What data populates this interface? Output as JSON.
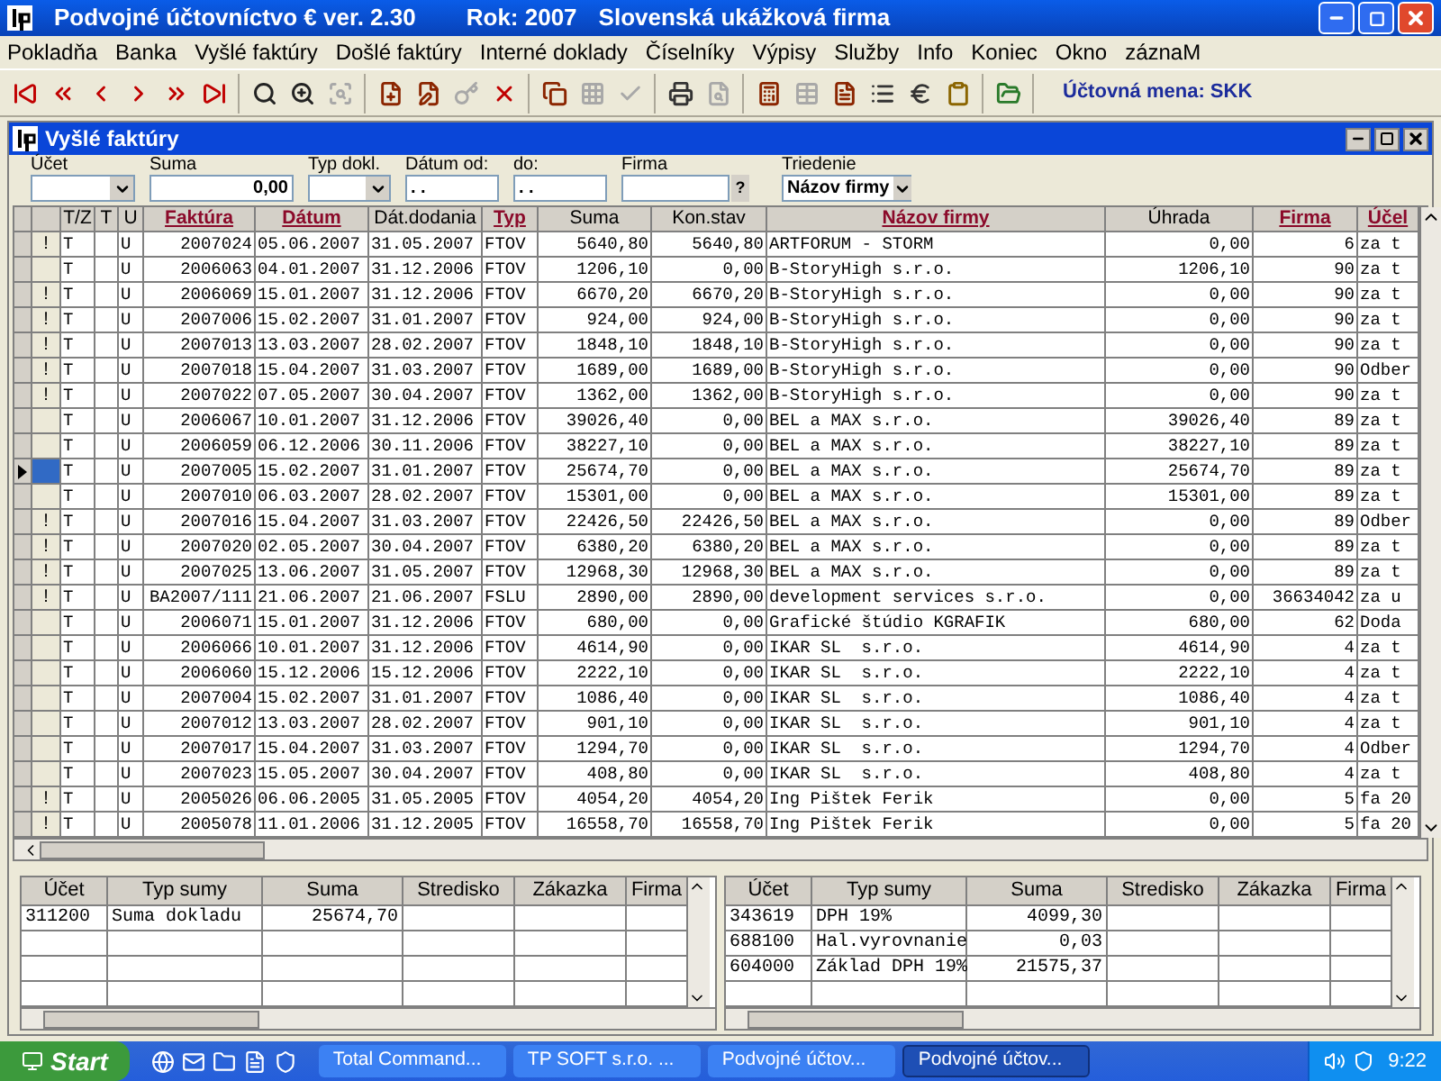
{
  "window": {
    "title": "Podvojné účtovníctvo € ver. 2.30",
    "year": "Rok: 2007",
    "company": "Slovenská ukážková firma"
  },
  "menu": [
    "Pokladňa",
    "Banka",
    "Vyšlé faktúry",
    "Došlé faktúry",
    "Interné doklady",
    "Číselníky",
    "Výpisy",
    "Služby",
    "Info",
    "Koniec",
    "Okno",
    "záznaM"
  ],
  "toolbar": {
    "groups": [
      [
        {
          "kind": "first",
          "disabled": false
        },
        {
          "kind": "prev-page",
          "disabled": false
        },
        {
          "kind": "prev",
          "disabled": false
        },
        {
          "kind": "next",
          "disabled": false
        },
        {
          "kind": "next-page",
          "disabled": false
        },
        {
          "kind": "last",
          "disabled": false
        }
      ],
      [
        {
          "kind": "search",
          "disabled": false
        },
        {
          "kind": "search-next",
          "disabled": false
        },
        {
          "kind": "filter",
          "disabled": true
        }
      ],
      [
        {
          "kind": "new",
          "disabled": false
        },
        {
          "kind": "edit",
          "disabled": false
        },
        {
          "kind": "key",
          "disabled": true
        },
        {
          "kind": "delete",
          "disabled": false
        }
      ],
      [
        {
          "kind": "copy",
          "disabled": false
        },
        {
          "kind": "grid",
          "disabled": true
        },
        {
          "kind": "check",
          "disabled": true
        }
      ],
      [
        {
          "kind": "print",
          "disabled": false
        },
        {
          "kind": "print-preview",
          "disabled": true
        }
      ],
      [
        {
          "kind": "calc",
          "disabled": false
        },
        {
          "kind": "table",
          "disabled": true
        },
        {
          "kind": "doc",
          "disabled": false
        },
        {
          "kind": "list",
          "disabled": false
        },
        {
          "kind": "euro",
          "disabled": false
        },
        {
          "kind": "clipboard",
          "disabled": false
        }
      ],
      [
        {
          "kind": "export",
          "disabled": false
        }
      ]
    ],
    "currency": "Účtovná mena: SKK"
  },
  "document_window": {
    "title": "Vyšlé faktúry"
  },
  "filters": [
    {
      "label": "Účet",
      "kind": "combo"
    },
    {
      "label": "Suma",
      "kind": "input",
      "value": "0,00"
    },
    {
      "label": "Typ dokl.",
      "kind": "combo"
    },
    {
      "label": "Dátum od:",
      "kind": "input",
      "value": ". ."
    },
    {
      "label": "do:",
      "kind": "input",
      "value": ". ."
    },
    {
      "label": "Firma",
      "kind": "lookup",
      "button": "?"
    },
    {
      "label": "Triedenie",
      "kind": "combo",
      "value": "Názov firmy"
    }
  ],
  "table": {
    "columns": [
      {
        "label": "T/Z",
        "sortable": false
      },
      {
        "label": "T",
        "sortable": false
      },
      {
        "label": "U",
        "sortable": false
      },
      {
        "label": "Faktúra",
        "sortable": true
      },
      {
        "label": "Dátum",
        "sortable": true
      },
      {
        "label": "Dát.dodania",
        "sortable": false
      },
      {
        "label": "Typ",
        "sortable": true
      },
      {
        "label": "Suma",
        "sortable": false
      },
      {
        "label": "Kon.stav",
        "sortable": false
      },
      {
        "label": "Názov firmy",
        "sortable": true
      },
      {
        "label": "Úhrada",
        "sortable": false
      },
      {
        "label": "Firma",
        "sortable": true
      },
      {
        "label": "Účel",
        "sortable": true
      }
    ],
    "rows": [
      {
        "selected": false,
        "flag": "!",
        "tz": "T",
        "u": "U",
        "invoice": "2007024",
        "date": "05.06.2007",
        "delivery": "31.05.2007",
        "type": "FTOV",
        "amount": "5640,80",
        "status": "5640,80",
        "company": "ARTFORUM - STORM",
        "payment": "0,00",
        "company_no": "6",
        "purpose": "za t"
      },
      {
        "selected": false,
        "tz": "T",
        "u": "U",
        "invoice": "2006063",
        "date": "04.01.2007",
        "delivery": "31.12.2006",
        "type": "FTOV",
        "amount": "1206,10",
        "status": "0,00",
        "company": "B-StoryHigh s.r.o.",
        "payment": "1206,10",
        "company_no": "90",
        "purpose": "za t"
      },
      {
        "selected": false,
        "flag": "!",
        "tz": "T",
        "u": "U",
        "invoice": "2006069",
        "date": "15.01.2007",
        "delivery": "31.12.2006",
        "type": "FTOV",
        "amount": "6670,20",
        "status": "6670,20",
        "company": "B-StoryHigh s.r.o.",
        "payment": "0,00",
        "company_no": "90",
        "purpose": "za t"
      },
      {
        "selected": false,
        "flag": "!",
        "tz": "T",
        "u": "U",
        "invoice": "2007006",
        "date": "15.02.2007",
        "delivery": "31.01.2007",
        "type": "FTOV",
        "amount": "924,00",
        "status": "924,00",
        "company": "B-StoryHigh s.r.o.",
        "payment": "0,00",
        "company_no": "90",
        "purpose": "za t"
      },
      {
        "selected": false,
        "flag": "!",
        "tz": "T",
        "u": "U",
        "invoice": "2007013",
        "date": "13.03.2007",
        "delivery": "28.02.2007",
        "type": "FTOV",
        "amount": "1848,10",
        "status": "1848,10",
        "company": "B-StoryHigh s.r.o.",
        "payment": "0,00",
        "company_no": "90",
        "purpose": "za t"
      },
      {
        "selected": false,
        "flag": "!",
        "tz": "T",
        "u": "U",
        "invoice": "2007018",
        "date": "15.04.2007",
        "delivery": "31.03.2007",
        "type": "FTOV",
        "amount": "1689,00",
        "status": "1689,00",
        "company": "B-StoryHigh s.r.o.",
        "payment": "0,00",
        "company_no": "90",
        "purpose": "Odber"
      },
      {
        "selected": false,
        "flag": "!",
        "tz": "T",
        "u": "U",
        "invoice": "2007022",
        "date": "07.05.2007",
        "delivery": "30.04.2007",
        "type": "FTOV",
        "amount": "1362,00",
        "status": "1362,00",
        "company": "B-StoryHigh s.r.o.",
        "payment": "0,00",
        "company_no": "90",
        "purpose": "za t"
      },
      {
        "selected": false,
        "tz": "T",
        "u": "U",
        "invoice": "2006067",
        "date": "10.01.2007",
        "delivery": "31.12.2006",
        "type": "FTOV",
        "amount": "39026,40",
        "status": "0,00",
        "company": "BEL a MAX s.r.o.",
        "payment": "39026,40",
        "company_no": "89",
        "purpose": "za t"
      },
      {
        "selected": false,
        "tz": "T",
        "u": "U",
        "invoice": "2006059",
        "date": "06.12.2006",
        "delivery": "30.11.2006",
        "type": "FTOV",
        "amount": "38227,10",
        "status": "0,00",
        "company": "BEL a MAX s.r.o.",
        "payment": "38227,10",
        "company_no": "89",
        "purpose": "za t"
      },
      {
        "selected": true,
        "tz": "T",
        "u": "U",
        "invoice": "2007005",
        "date": "15.02.2007",
        "delivery": "31.01.2007",
        "type": "FTOV",
        "amount": "25674,70",
        "status": "0,00",
        "company": "BEL a MAX s.r.o.",
        "payment": "25674,70",
        "company_no": "89",
        "purpose": "za t"
      },
      {
        "selected": false,
        "tz": "T",
        "u": "U",
        "invoice": "2007010",
        "date": "06.03.2007",
        "delivery": "28.02.2007",
        "type": "FTOV",
        "amount": "15301,00",
        "status": "0,00",
        "company": "BEL a MAX s.r.o.",
        "payment": "15301,00",
        "company_no": "89",
        "purpose": "za t"
      },
      {
        "selected": false,
        "flag": "!",
        "tz": "T",
        "u": "U",
        "invoice": "2007016",
        "date": "15.04.2007",
        "delivery": "31.03.2007",
        "type": "FTOV",
        "amount": "22426,50",
        "status": "22426,50",
        "company": "BEL a MAX s.r.o.",
        "payment": "0,00",
        "company_no": "89",
        "purpose": "Odber"
      },
      {
        "selected": false,
        "flag": "!",
        "tz": "T",
        "u": "U",
        "invoice": "2007020",
        "date": "02.05.2007",
        "delivery": "30.04.2007",
        "type": "FTOV",
        "amount": "6380,20",
        "status": "6380,20",
        "company": "BEL a MAX s.r.o.",
        "payment": "0,00",
        "company_no": "89",
        "purpose": "za t"
      },
      {
        "selected": false,
        "flag": "!",
        "tz": "T",
        "u": "U",
        "invoice": "2007025",
        "date": "13.06.2007",
        "delivery": "31.05.2007",
        "type": "FTOV",
        "amount": "12968,30",
        "status": "12968,30",
        "company": "BEL a MAX s.r.o.",
        "payment": "0,00",
        "company_no": "89",
        "purpose": "za t"
      },
      {
        "selected": false,
        "flag": "!",
        "tz": "T",
        "u": "U",
        "invoice": "BA2007/111",
        "date": "21.06.2007",
        "delivery": "21.06.2007",
        "type": "FSLU",
        "amount": "2890,00",
        "status": "2890,00",
        "company": "development services s.r.o.",
        "payment": "0,00",
        "company_no": "36634042",
        "purpose": "za u"
      },
      {
        "selected": false,
        "tz": "T",
        "u": "U",
        "invoice": "2006071",
        "date": "15.01.2007",
        "delivery": "31.12.2006",
        "type": "FTOV",
        "amount": "680,00",
        "status": "0,00",
        "company": "Grafické štúdio KGRAFIK",
        "payment": "680,00",
        "company_no": "62",
        "purpose": "Doda"
      },
      {
        "selected": false,
        "tz": "T",
        "u": "U",
        "invoice": "2006066",
        "date": "10.01.2007",
        "delivery": "31.12.2006",
        "type": "FTOV",
        "amount": "4614,90",
        "status": "0,00",
        "company": "IKAR SL  s.r.o.",
        "payment": "4614,90",
        "company_no": "4",
        "purpose": "za t"
      },
      {
        "selected": false,
        "tz": "T",
        "u": "U",
        "invoice": "2006060",
        "date": "15.12.2006",
        "delivery": "15.12.2006",
        "type": "FTOV",
        "amount": "2222,10",
        "status": "0,00",
        "company": "IKAR SL  s.r.o.",
        "payment": "2222,10",
        "company_no": "4",
        "purpose": "za t"
      },
      {
        "selected": false,
        "tz": "T",
        "u": "U",
        "invoice": "2007004",
        "date": "15.02.2007",
        "delivery": "31.01.2007",
        "type": "FTOV",
        "amount": "1086,40",
        "status": "0,00",
        "company": "IKAR SL  s.r.o.",
        "payment": "1086,40",
        "company_no": "4",
        "purpose": "za t"
      },
      {
        "selected": false,
        "tz": "T",
        "u": "U",
        "invoice": "2007012",
        "date": "13.03.2007",
        "delivery": "28.02.2007",
        "type": "FTOV",
        "amount": "901,10",
        "status": "0,00",
        "company": "IKAR SL  s.r.o.",
        "payment": "901,10",
        "company_no": "4",
        "purpose": "za t"
      },
      {
        "selected": false,
        "tz": "T",
        "u": "U",
        "invoice": "2007017",
        "date": "15.04.2007",
        "delivery": "31.03.2007",
        "type": "FTOV",
        "amount": "1294,70",
        "status": "0,00",
        "company": "IKAR SL  s.r.o.",
        "payment": "1294,70",
        "company_no": "4",
        "purpose": "Odber"
      },
      {
        "selected": false,
        "tz": "T",
        "u": "U",
        "invoice": "2007023",
        "date": "15.05.2007",
        "delivery": "30.04.2007",
        "type": "FTOV",
        "amount": "408,80",
        "status": "0,00",
        "company": "IKAR SL  s.r.o.",
        "payment": "408,80",
        "company_no": "4",
        "purpose": "za t"
      },
      {
        "selected": false,
        "flag": "!",
        "tz": "T",
        "u": "U",
        "invoice": "2005026",
        "date": "06.06.2005",
        "delivery": "31.05.2005",
        "type": "FTOV",
        "amount": "4054,20",
        "status": "4054,20",
        "company": "Ing Pištek Ferik",
        "payment": "0,00",
        "company_no": "5",
        "purpose": "fa 20"
      },
      {
        "selected": false,
        "flag": "!",
        "tz": "T",
        "u": "U",
        "invoice": "2005078",
        "date": "11.01.2006",
        "delivery": "31.12.2005",
        "type": "FTOV",
        "amount": "16558,70",
        "status": "16558,70",
        "company": "Ing Pištek Ferik",
        "payment": "0,00",
        "company_no": "5",
        "purpose": "fa 20"
      }
    ]
  },
  "postings": [
    {
      "columns": [
        "Účet",
        "Typ sumy",
        "Suma",
        "Stredisko",
        "Zákazka",
        "Firma"
      ],
      "rows": [
        {
          "account": "311200",
          "type": "Suma dokladu",
          "amount": "25674,70"
        }
      ]
    },
    {
      "columns": [
        "Účet",
        "Typ sumy",
        "Suma",
        "Stredisko",
        "Zákazka",
        "Firma"
      ],
      "rows": [
        {
          "account": "343619",
          "type": "DPH 19%",
          "amount": "4099,30"
        },
        {
          "account": "688100",
          "type": "Hal.vyrovnanie",
          "amount": "0,03"
        },
        {
          "account": "604000",
          "type": "Základ DPH 19%",
          "amount": "21575,37"
        }
      ]
    }
  ],
  "taskbar": {
    "start": "Start",
    "tasks": [
      {
        "label": "Total Command...",
        "selected": false
      },
      {
        "label": "TP SOFT s.r.o. ...",
        "selected": false
      },
      {
        "label": "Podvojné účtov...",
        "selected": false
      },
      {
        "label": "Podvojné účtov...",
        "selected": true
      }
    ],
    "clock": "9:22"
  }
}
